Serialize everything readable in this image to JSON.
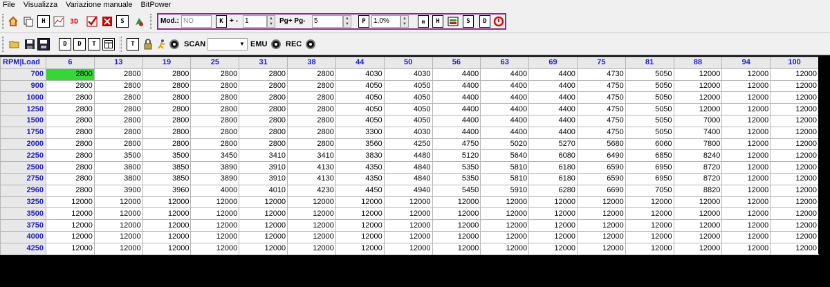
{
  "menu": [
    "File",
    "Visualizza",
    "Variazione manuale",
    "BitPower"
  ],
  "toolbar1": {
    "left_icons": [
      "home-icon",
      "copy-icon",
      "table-h-icon",
      "chart-icon",
      "3d-icon",
      "check-icon",
      "delete-icon",
      "table-s-icon",
      "run-icon"
    ],
    "mod_label": "Mod.:",
    "mod_value": "NO",
    "k_label": "K",
    "plusminus_label": "+ -",
    "plusminus_value": "1",
    "pg_label": "Pg+ Pg-",
    "pg_value": "5",
    "p_label": "P",
    "percent_value": "1,0%",
    "right_icons": [
      "m-icon",
      "h-icon",
      "map-icon",
      "s-icon",
      "d-icon",
      "restore-icon"
    ]
  },
  "toolbar2": {
    "scan_label": "SCAN",
    "emu_label": "EMU",
    "rec_label": "REC",
    "scan_value": ""
  },
  "table": {
    "corner": "RPM|Load",
    "columns": [
      "6",
      "13",
      "19",
      "25",
      "31",
      "38",
      "44",
      "50",
      "56",
      "63",
      "69",
      "75",
      "81",
      "88",
      "94",
      "100"
    ],
    "rows": [
      {
        "rpm": "700",
        "v": [
          "2800",
          "2800",
          "2800",
          "2800",
          "2800",
          "2800",
          "4030",
          "4030",
          "4400",
          "4400",
          "4400",
          "4730",
          "5050",
          "12000",
          "12000",
          "12000"
        ]
      },
      {
        "rpm": "900",
        "v": [
          "2800",
          "2800",
          "2800",
          "2800",
          "2800",
          "2800",
          "4050",
          "4050",
          "4400",
          "4400",
          "4400",
          "4750",
          "5050",
          "12000",
          "12000",
          "12000"
        ]
      },
      {
        "rpm": "1000",
        "v": [
          "2800",
          "2800",
          "2800",
          "2800",
          "2800",
          "2800",
          "4050",
          "4050",
          "4400",
          "4400",
          "4400",
          "4750",
          "5050",
          "12000",
          "12000",
          "12000"
        ]
      },
      {
        "rpm": "1250",
        "v": [
          "2800",
          "2800",
          "2800",
          "2800",
          "2800",
          "2800",
          "4050",
          "4050",
          "4400",
          "4400",
          "4400",
          "4750",
          "5050",
          "12000",
          "12000",
          "12000"
        ]
      },
      {
        "rpm": "1500",
        "v": [
          "2800",
          "2800",
          "2800",
          "2800",
          "2800",
          "2800",
          "4050",
          "4050",
          "4400",
          "4400",
          "4400",
          "4750",
          "5050",
          "7000",
          "12000",
          "12000"
        ]
      },
      {
        "rpm": "1750",
        "v": [
          "2800",
          "2800",
          "2800",
          "2800",
          "2800",
          "2800",
          "3300",
          "4030",
          "4400",
          "4400",
          "4400",
          "4750",
          "5050",
          "7400",
          "12000",
          "12000"
        ]
      },
      {
        "rpm": "2000",
        "v": [
          "2800",
          "2800",
          "2800",
          "2800",
          "2800",
          "2800",
          "3560",
          "4250",
          "4750",
          "5020",
          "5270",
          "5680",
          "6060",
          "7800",
          "12000",
          "12000"
        ]
      },
      {
        "rpm": "2250",
        "v": [
          "2800",
          "3500",
          "3500",
          "3450",
          "3410",
          "3410",
          "3830",
          "4480",
          "5120",
          "5640",
          "6080",
          "6490",
          "6850",
          "8240",
          "12000",
          "12000"
        ]
      },
      {
        "rpm": "2500",
        "v": [
          "2800",
          "3800",
          "3850",
          "3890",
          "3910",
          "4130",
          "4350",
          "4840",
          "5350",
          "5810",
          "6180",
          "6590",
          "6950",
          "8720",
          "12000",
          "12000"
        ]
      },
      {
        "rpm": "2750",
        "v": [
          "2800",
          "3800",
          "3850",
          "3890",
          "3910",
          "4130",
          "4350",
          "4840",
          "5350",
          "5810",
          "6180",
          "6590",
          "6950",
          "8720",
          "12000",
          "12000"
        ]
      },
      {
        "rpm": "2960",
        "v": [
          "2800",
          "3900",
          "3960",
          "4000",
          "4010",
          "4230",
          "4450",
          "4940",
          "5450",
          "5910",
          "6280",
          "6690",
          "7050",
          "8820",
          "12000",
          "12000"
        ]
      },
      {
        "rpm": "3250",
        "v": [
          "12000",
          "12000",
          "12000",
          "12000",
          "12000",
          "12000",
          "12000",
          "12000",
          "12000",
          "12000",
          "12000",
          "12000",
          "12000",
          "12000",
          "12000",
          "12000"
        ]
      },
      {
        "rpm": "3500",
        "v": [
          "12000",
          "12000",
          "12000",
          "12000",
          "12000",
          "12000",
          "12000",
          "12000",
          "12000",
          "12000",
          "12000",
          "12000",
          "12000",
          "12000",
          "12000",
          "12000"
        ]
      },
      {
        "rpm": "3750",
        "v": [
          "12000",
          "12000",
          "12000",
          "12000",
          "12000",
          "12000",
          "12000",
          "12000",
          "12000",
          "12000",
          "12000",
          "12000",
          "12000",
          "12000",
          "12000",
          "12000"
        ]
      },
      {
        "rpm": "4000",
        "v": [
          "12000",
          "12000",
          "12000",
          "12000",
          "12000",
          "12000",
          "12000",
          "12000",
          "12000",
          "12000",
          "12000",
          "12000",
          "12000",
          "12000",
          "12000",
          "12000"
        ]
      },
      {
        "rpm": "4250",
        "v": [
          "12000",
          "12000",
          "12000",
          "12000",
          "12000",
          "12000",
          "12000",
          "12000",
          "12000",
          "12000",
          "12000",
          "12000",
          "12000",
          "12000",
          "12000",
          "12000"
        ]
      }
    ],
    "selected_cell": {
      "row": 0,
      "col": 0
    },
    "selected_color": "#34d834",
    "header_text_color": "#1c1ccc"
  }
}
